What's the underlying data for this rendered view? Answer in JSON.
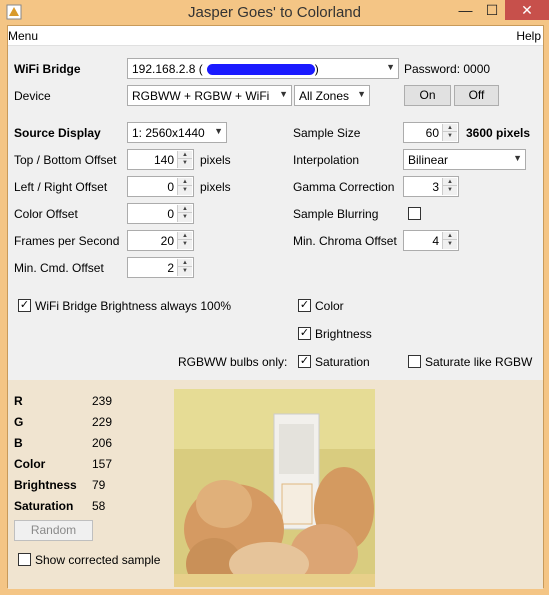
{
  "window": {
    "title": "Jasper Goes' to Colorland",
    "minimize": "—",
    "maximize": "☐",
    "close": "✕"
  },
  "menu": {
    "left": "Menu",
    "right": "Help"
  },
  "wifi": {
    "label": "WiFi Bridge",
    "ip": "192.168.2.8 (",
    "ip_close": ")",
    "redaction_color": "#1a1aff",
    "password": "Password: 0000"
  },
  "device": {
    "label": "Device",
    "type": "RGBWW + RGBW + WiFi",
    "zone": "All Zones",
    "on": "On",
    "off": "Off"
  },
  "left_fields": {
    "source_display": {
      "label": "Source Display",
      "value": "1: 2560x1440"
    },
    "top_bottom": {
      "label": "Top / Bottom Offset",
      "value": "140",
      "unit": "pixels"
    },
    "left_right": {
      "label": "Left / Right Offset",
      "value": "0",
      "unit": "pixels"
    },
    "color_offset": {
      "label": "Color Offset",
      "value": "0"
    },
    "fps": {
      "label": "Frames per Second",
      "value": "20"
    },
    "min_cmd": {
      "label": "Min. Cmd. Offset",
      "value": "2"
    }
  },
  "right_fields": {
    "sample_size": {
      "label": "Sample Size",
      "value": "60",
      "unit": "3600 pixels"
    },
    "interpolation": {
      "label": "Interpolation",
      "value": "Bilinear"
    },
    "gamma": {
      "label": "Gamma Correction",
      "value": "3"
    },
    "blurring": {
      "label": "Sample Blurring",
      "checked": false
    },
    "min_chroma": {
      "label": "Min. Chroma Offset",
      "value": "4"
    }
  },
  "checks": {
    "wifi_brightness": {
      "label": "WiFi Bridge Brightness always 100%",
      "checked": true
    },
    "color": {
      "label": "Color",
      "checked": true
    },
    "brightness": {
      "label": "Brightness",
      "checked": true
    },
    "rgbww_only": "RGBWW bulbs only:",
    "saturation": {
      "label": "Saturation",
      "checked": true
    },
    "saturate_rgbw": {
      "label": "Saturate like RGBW",
      "checked": false
    }
  },
  "stats": [
    {
      "label": "R",
      "value": "239",
      "bold": true
    },
    {
      "label": "G",
      "value": "229",
      "bold": true
    },
    {
      "label": "B",
      "value": "206",
      "bold": true
    },
    {
      "label": "Color",
      "value": "157",
      "bold": true
    },
    {
      "label": "Brightness",
      "value": "79",
      "bold": true
    },
    {
      "label": "Saturation",
      "value": "58",
      "bold": true
    }
  ],
  "random_button": "Random",
  "show_corrected": {
    "label": "Show corrected sample",
    "checked": false
  },
  "colors": {
    "frame": "#f4c585",
    "close_red": "#c7504b",
    "panel": "#f0f0f0",
    "bottom_panel": "#f0e4d0"
  }
}
